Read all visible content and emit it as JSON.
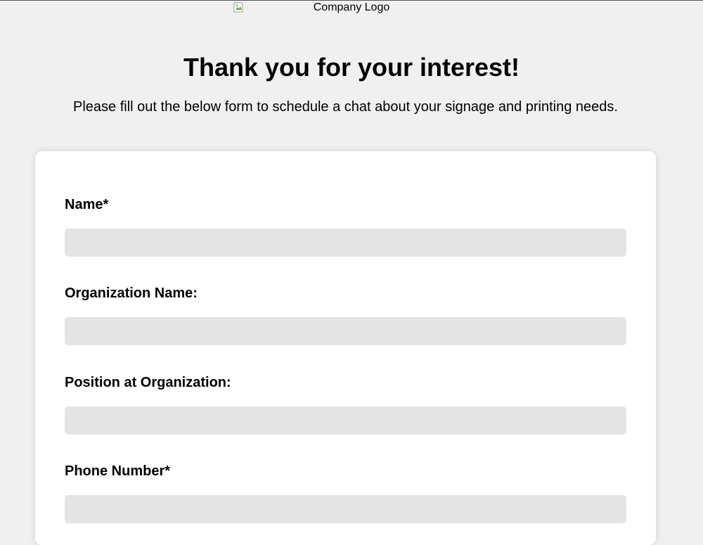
{
  "header": {
    "logo_alt": "Company Logo",
    "title": "Thank you for your interest!",
    "subtitle": "Please fill out the below form to schedule a chat about your signage and printing needs."
  },
  "form": {
    "fields": [
      {
        "label": "Name*",
        "value": "",
        "placeholder": ""
      },
      {
        "label": "Organization Name:",
        "value": "",
        "placeholder": ""
      },
      {
        "label": "Position at Organization:",
        "value": "",
        "placeholder": ""
      },
      {
        "label": "Phone Number*",
        "value": "",
        "placeholder": ""
      }
    ]
  },
  "colors": {
    "page_background": "#f0f0f0",
    "card_background": "#ffffff",
    "input_background": "#e4e4e4",
    "text": "#000000"
  },
  "icons": {
    "logo_image": "broken-image-icon"
  }
}
